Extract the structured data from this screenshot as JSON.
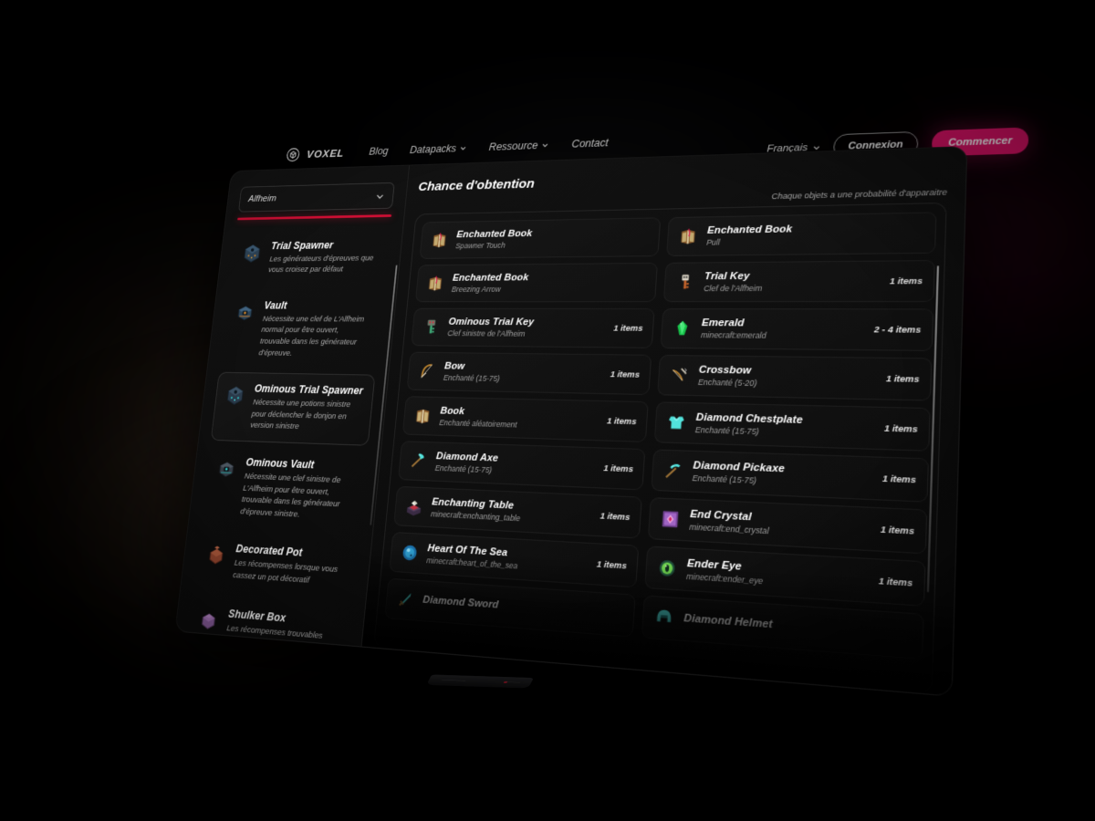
{
  "nav": {
    "brand": "VOXEL",
    "brand_icon": "cube-icon",
    "links": [
      {
        "label": "Blog",
        "has_caret": false
      },
      {
        "label": "Datapacks",
        "has_caret": true
      },
      {
        "label": "Ressource",
        "has_caret": true
      },
      {
        "label": "Contact",
        "has_caret": false
      }
    ],
    "language": "Français",
    "login_label": "Connexion",
    "cta_label": "Commencer",
    "cta_color": "#dd1268",
    "accent_underline_color": "#cf0f34"
  },
  "sidebar": {
    "select_value": "Alfheim",
    "items": [
      {
        "name": "Trial Spawner",
        "desc": "Les générateurs d'épreuves que vous croisez par défaut",
        "icon": "trial-spawner-icon",
        "active": false
      },
      {
        "name": "Vault",
        "desc": "Nécessite une clef de L'Alfheim normal pour être ouvert, trouvable dans les générateur d'épreuve.",
        "icon": "vault-icon",
        "active": false
      },
      {
        "name": "Ominous Trial Spawner",
        "desc": "Nécessite une potions sinistre pour déclencher le donjon en version sinistre",
        "icon": "ominous-trial-spawner-icon",
        "active": true
      },
      {
        "name": "Ominous Vault",
        "desc": "Nécessite une clef sinistre de L'Alfheim pour être ouvert, trouvable dans les générateur d'épreuve sinistre.",
        "icon": "ominous-vault-icon",
        "active": false
      },
      {
        "name": "Decorated Pot",
        "desc": "Les récompenses lorsque vous cassez un pot décoratif",
        "icon": "decorated-pot-icon",
        "active": false
      },
      {
        "name": "Shulker Box",
        "desc": "Les récompenses trouvables dans un shulker box",
        "icon": "shulker-box-icon",
        "active": false
      }
    ]
  },
  "main": {
    "title": "Chance d'obtention",
    "subtitle": "Chaque objets a une probabilité d'apparaitre",
    "items": [
      {
        "name": "Enchanted Book",
        "sub": "Spawner Touch",
        "count": "",
        "icon": "enchanted-book-icon"
      },
      {
        "name": "Enchanted Book",
        "sub": "Pull",
        "count": "",
        "icon": "enchanted-book-icon"
      },
      {
        "name": "Enchanted Book",
        "sub": "Breezing Arrow",
        "count": "",
        "icon": "enchanted-book-icon"
      },
      {
        "name": "Trial Key",
        "sub": "Clef de l'Alfheim",
        "count": "1 items",
        "icon": "trial-key-icon"
      },
      {
        "name": "Ominous Trial Key",
        "sub": "Clef sinistre de l'Alfheim",
        "count": "1 items",
        "icon": "ominous-trial-key-icon"
      },
      {
        "name": "Emerald",
        "sub": "minecraft:emerald",
        "count": "2 - 4 items",
        "icon": "emerald-icon"
      },
      {
        "name": "Bow",
        "sub": "Enchanté (15-75)",
        "count": "1 items",
        "icon": "bow-icon"
      },
      {
        "name": "Crossbow",
        "sub": "Enchanté (5-20)",
        "count": "1 items",
        "icon": "crossbow-icon"
      },
      {
        "name": "Book",
        "sub": "Enchanté aléatoirement",
        "count": "1 items",
        "icon": "book-icon"
      },
      {
        "name": "Diamond Chestplate",
        "sub": "Enchanté (15-75)",
        "count": "1 items",
        "icon": "diamond-chestplate-icon"
      },
      {
        "name": "Diamond Axe",
        "sub": "Enchanté (15-75)",
        "count": "1 items",
        "icon": "diamond-axe-icon"
      },
      {
        "name": "Diamond Pickaxe",
        "sub": "Enchanté (15-75)",
        "count": "1 items",
        "icon": "diamond-pickaxe-icon"
      },
      {
        "name": "Enchanting Table",
        "sub": "minecraft:enchanting_table",
        "count": "1 items",
        "icon": "enchanting-table-icon"
      },
      {
        "name": "End Crystal",
        "sub": "minecraft:end_crystal",
        "count": "1 items",
        "icon": "end-crystal-icon"
      },
      {
        "name": "Heart Of The Sea",
        "sub": "minecraft:heart_of_the_sea",
        "count": "1 items",
        "icon": "heart-of-the-sea-icon"
      },
      {
        "name": "Ender Eye",
        "sub": "minecraft:ender_eye",
        "count": "1 items",
        "icon": "ender-eye-icon"
      },
      {
        "name": "Diamond Sword",
        "sub": "",
        "count": "",
        "icon": "diamond-sword-icon"
      },
      {
        "name": "Diamond Helmet",
        "sub": "",
        "count": "",
        "icon": "diamond-helmet-icon"
      }
    ]
  }
}
